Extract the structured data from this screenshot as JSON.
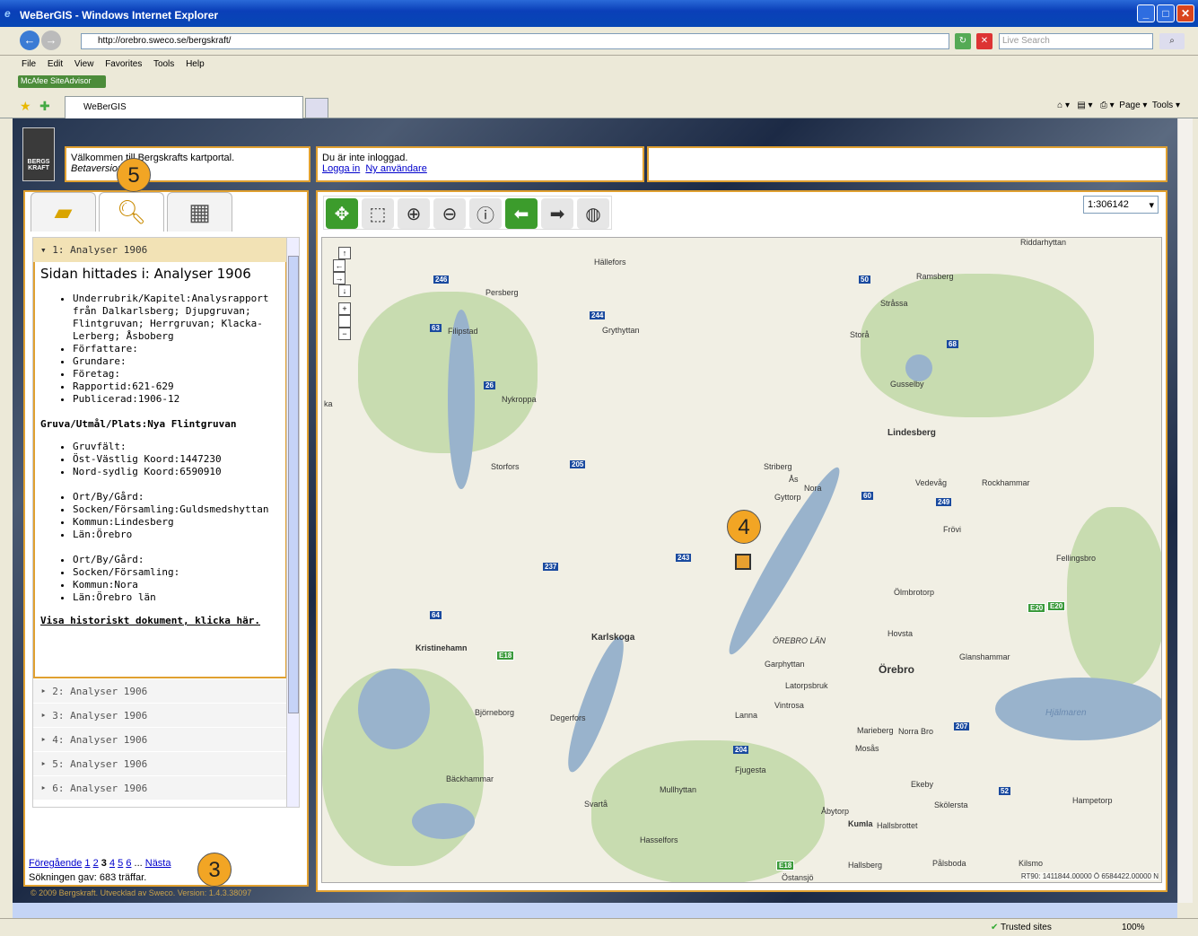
{
  "window": {
    "title": "WeBerGIS - Windows Internet Explorer"
  },
  "browser": {
    "url": "http://orebro.sweco.se/bergskraft/",
    "search_placeholder": "Live Search",
    "menu": [
      "File",
      "Edit",
      "View",
      "Favorites",
      "Tools",
      "Help"
    ],
    "siteadvisor": "McAfee SiteAdvisor",
    "tab_title": "WeBerGIS",
    "page_label": "Page",
    "tools_label": "Tools"
  },
  "header": {
    "welcome": "Välkommen till Bergskrafts kartportal.",
    "beta": "Betaversion",
    "login_status": "Du är inte inloggad.",
    "login_link": "Logga in",
    "new_user_link": "Ny användare",
    "logo_text": "BERGS KRAFT"
  },
  "results": {
    "first": {
      "label": "▾ 1: Analyser 1906",
      "title": "Sidan hittades i: Analyser 1906",
      "list1": [
        "Underrubrik/Kapitel:Analysrapport från Dalkarlsberg; Djupgruvan; Flintgruvan; Herrgruvan; Klacka-Lerberg; Åsboberg",
        "Författare:",
        "Grundare:",
        "Företag:",
        "Rapportid:621-629",
        "Publicerad:1906-12"
      ],
      "subheading": "Gruva/Utmål/Plats:Nya Flintgruvan",
      "list2": [
        "Gruvfält:",
        "Öst-Västlig Koord:1447230",
        "Nord-sydlig Koord:6590910"
      ],
      "list3": [
        "Ort/By/Gård:",
        "Socken/Församling:Guldsmedshyttan",
        "Kommun:Lindesberg",
        "Län:Örebro"
      ],
      "list4": [
        "Ort/By/Gård:",
        "Socken/Församling:",
        "Kommun:Nora",
        "Län:Örebro län"
      ],
      "doc_link": "Visa historiskt dokument, klicka här."
    },
    "others": [
      "‣ 2: Analyser 1906",
      "‣ 3: Analyser 1906",
      "‣ 4: Analyser 1906",
      "‣ 5: Analyser 1906",
      "‣ 6: Analyser 1906"
    ]
  },
  "pager": {
    "prev": "Föregående",
    "pages": [
      "1",
      "2",
      "3",
      "4",
      "5",
      "6"
    ],
    "ellipsis": "...",
    "next": "Nästa",
    "summary": "Sökningen gav: 683 träffar."
  },
  "footer": "© 2009 Bergskraft. Utvecklad av Sweco. Version: 1.4.3.38097",
  "map": {
    "scale": "1:306142",
    "coords": "RT90: 1411844.00000 Ö 6584422.00000 N",
    "ka_label": "ka",
    "cities": [
      "Hällefors",
      "Persberg",
      "Grythyttan",
      "Filipstad",
      "Ramsberg",
      "Stråssa",
      "Storå",
      "Nykroppa",
      "Guldsmedshyttan",
      "Gusselby",
      "Lindesberg",
      "Storfors",
      "Striberg",
      "Ås",
      "Nora",
      "Gyttorp",
      "Vedevåg",
      "Rockhammar",
      "Frövi",
      "Fellingsbro",
      "Ölmbrotorp",
      "Karlskoga",
      "Kristinehamn",
      "Hovsta",
      "ÖREBRO LÄN",
      "Garphyttan",
      "Glanshammar",
      "Latorpsbruk",
      "Vintrosa",
      "Björneborg",
      "Degerfors",
      "Lanna",
      "Marieberg",
      "Norra Bro",
      "Mosås",
      "Fjugesta",
      "Hjälmaren",
      "Bäckhammar",
      "Mullhyttan",
      "Ekeby",
      "Svartå",
      "Hampetorp",
      "Skölersta",
      "Åbytorp",
      "Hallsbrottet",
      "Hasselfors",
      "Pålsboda",
      "Kilsmo",
      "Östansjö",
      "Hallsberg",
      "Riddarhyttan",
      "Kumla",
      "Kumla",
      "Örebro"
    ],
    "roads": [
      "246",
      "50",
      "244",
      "63",
      "68",
      "26",
      "205",
      "60",
      "249",
      "243",
      "237",
      "64",
      "E18",
      "E20",
      "207",
      "204",
      "52",
      "E18",
      "E20"
    ]
  },
  "callouts": [
    "5",
    "4",
    "3"
  ],
  "status": {
    "zone": "Trusted sites",
    "zoom": "100%"
  }
}
